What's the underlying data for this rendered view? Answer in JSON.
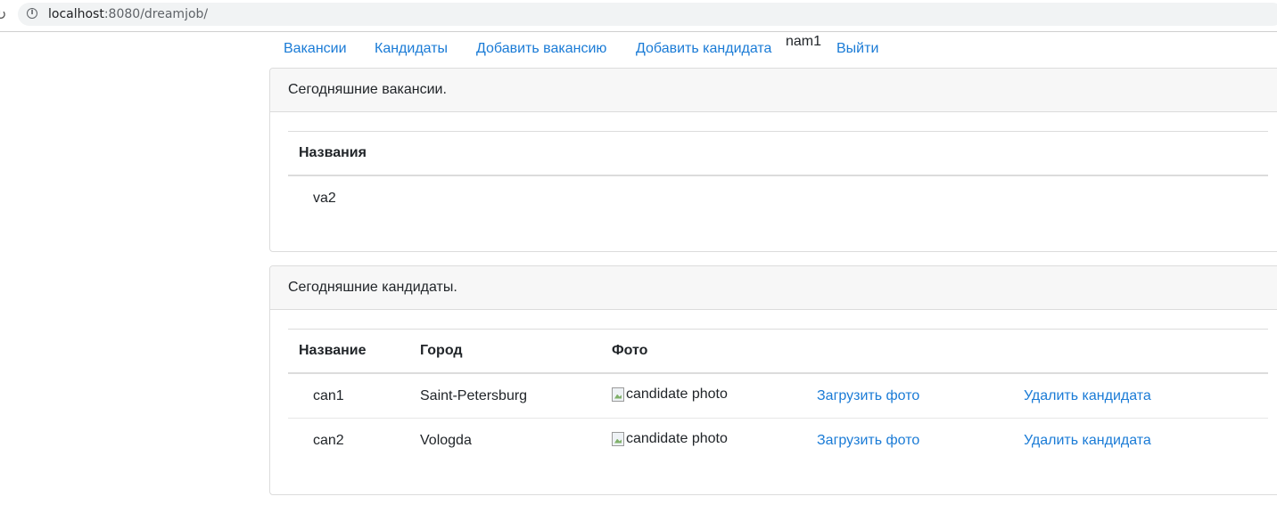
{
  "browser": {
    "url_host": "localhost",
    "url_rest": ":8080/dreamjob/"
  },
  "nav": {
    "vacancies": "Вакансии",
    "candidates": "Кандидаты",
    "add_vacancy": "Добавить вакансию",
    "add_candidate": "Добавить кандидата",
    "user_name": "nam1",
    "logout": "Выйти"
  },
  "vacancies_card": {
    "title": "Сегодняшние вакансии.",
    "header_name": "Названия",
    "rows": [
      {
        "name": "va2"
      }
    ]
  },
  "candidates_card": {
    "title": "Сегодняшние кандидаты.",
    "headers": {
      "name": "Название",
      "city": "Город",
      "photo": "Фото"
    },
    "rows": [
      {
        "name": "can1",
        "city": "Saint-Petersburg",
        "photo_alt": "candidate photo",
        "upload": "Загрузить фото",
        "delete": "Удалить кандидата"
      },
      {
        "name": "can2",
        "city": "Vologda",
        "photo_alt": "candidate photo",
        "upload": "Загрузить фото",
        "delete": "Удалить кандидата"
      }
    ]
  }
}
